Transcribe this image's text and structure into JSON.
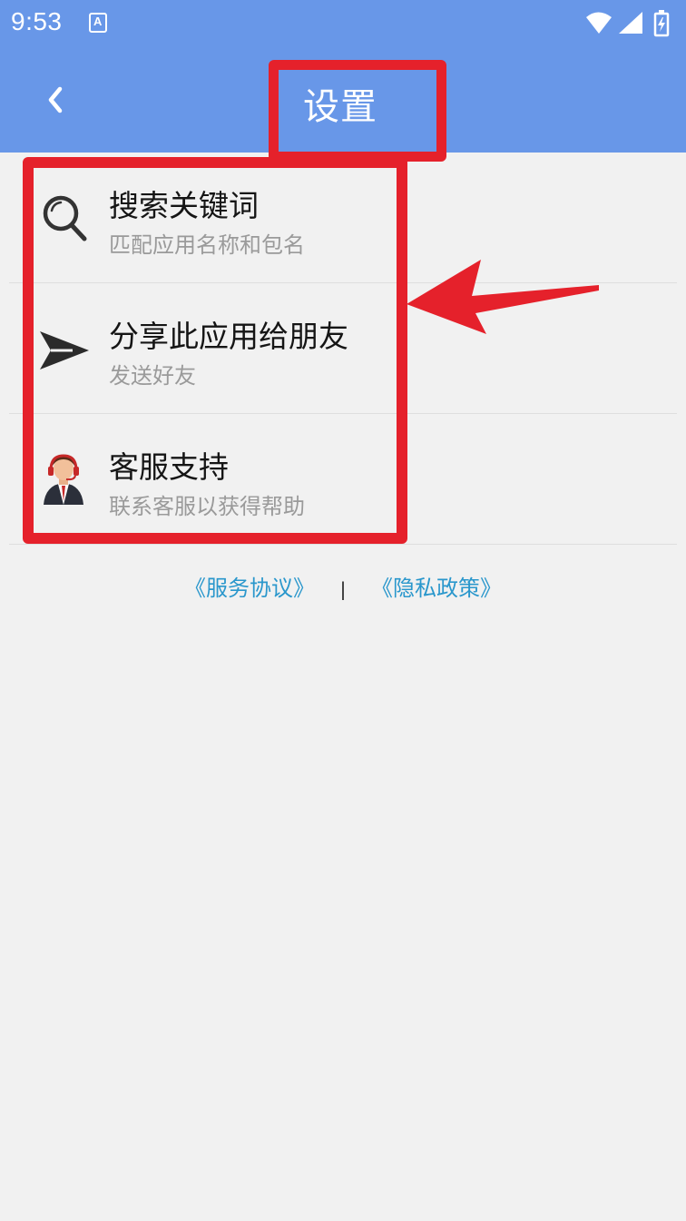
{
  "status_bar": {
    "time": "9:53",
    "notification_letter": "A",
    "icons": [
      "wifi-icon",
      "cellular-signal-icon",
      "battery-charging-icon"
    ]
  },
  "header": {
    "title": "设置",
    "back_icon": "chevron-left-icon",
    "background_color": "#6897e8"
  },
  "settings": {
    "items": [
      {
        "title": "搜索关键词",
        "subtitle": "匹配应用名称和包名",
        "icon": "search-icon"
      },
      {
        "title": "分享此应用给朋友",
        "subtitle": "发送好友",
        "icon": "send-icon"
      },
      {
        "title": "客服支持",
        "subtitle": "联系客服以获得帮助",
        "icon": "customer-service-agent-icon"
      }
    ]
  },
  "footer": {
    "service_agreement": "《服务协议》",
    "separator": "|",
    "privacy_policy": "《隐私政策》",
    "link_color": "#2a97cc"
  },
  "annotations": {
    "highlight_color": "#e5212b"
  }
}
